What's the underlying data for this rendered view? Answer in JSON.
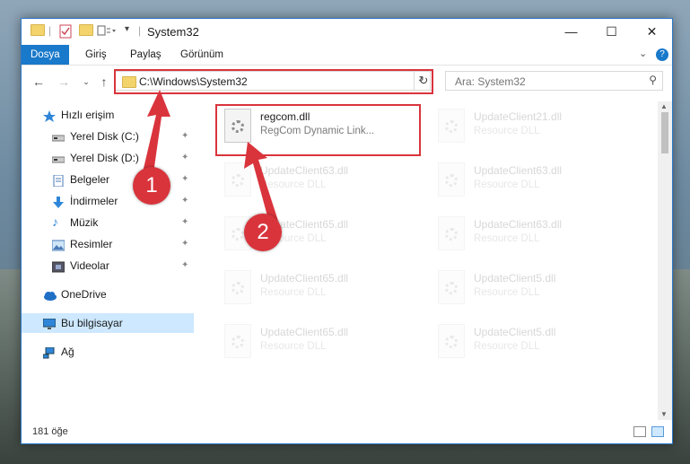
{
  "window": {
    "title": "System32",
    "controls": {
      "minimize": "—",
      "maximize": "☐",
      "close": "✕"
    }
  },
  "ribbon": {
    "tabs": [
      {
        "label": "Dosya",
        "active": true
      },
      {
        "label": "Giriş"
      },
      {
        "label": "Paylaş"
      },
      {
        "label": "Görünüm"
      }
    ]
  },
  "address": {
    "path": "C:\\Windows\\System32",
    "search_placeholder": "Ara: System32"
  },
  "nav": {
    "items": [
      {
        "label": "Hızlı erişim",
        "icon": "star-icon",
        "pinned": false
      },
      {
        "label": "Yerel Disk (C:)",
        "icon": "drive-icon",
        "pinned": true
      },
      {
        "label": "Yerel Disk (D:)",
        "icon": "drive-icon",
        "pinned": true
      },
      {
        "label": "Belgeler",
        "icon": "documents-icon",
        "pinned": true
      },
      {
        "label": "İndirmeler",
        "icon": "download-icon",
        "pinned": true
      },
      {
        "label": "Müzik",
        "icon": "music-icon",
        "pinned": true
      },
      {
        "label": "Resimler",
        "icon": "pictures-icon",
        "pinned": true
      },
      {
        "label": "Videolar",
        "icon": "videos-icon",
        "pinned": true
      },
      {
        "label": "OneDrive",
        "icon": "cloud-icon",
        "pinned": false
      },
      {
        "label": "Bu bilgisayar",
        "icon": "computer-icon",
        "pinned": false,
        "selected": true
      },
      {
        "label": "Ağ",
        "icon": "network-icon",
        "pinned": false
      }
    ],
    "pin_glyph": "📌"
  },
  "files": [
    {
      "name": "regcom.dll",
      "desc": "RegCom Dynamic Link...",
      "faded": false
    },
    {
      "name": "UpdateClient21.dll",
      "desc": "Resource DLL",
      "faded": true
    },
    {
      "name": "UpdateClient63.dll",
      "desc": "Resource DLL",
      "faded": true
    },
    {
      "name": "UpdateClient63.dll",
      "desc": "Resource DLL",
      "faded": true
    },
    {
      "name": "UpdateClient65.dll",
      "desc": "Resource DLL",
      "faded": true
    },
    {
      "name": "UpdateClient63.dll",
      "desc": "Resource DLL",
      "faded": true
    },
    {
      "name": "UpdateClient65.dll",
      "desc": "Resource DLL",
      "faded": true
    },
    {
      "name": "UpdateClient5.dll",
      "desc": "Resource DLL",
      "faded": true
    },
    {
      "name": "UpdateClient65.dll",
      "desc": "Resource DLL",
      "faded": true
    },
    {
      "name": "UpdateClient5.dll",
      "desc": "Resource DLL",
      "faded": true
    }
  ],
  "status": {
    "count": "181 öğe"
  },
  "callouts": {
    "step1": "1",
    "step2": "2",
    "color": "#d9343c"
  }
}
